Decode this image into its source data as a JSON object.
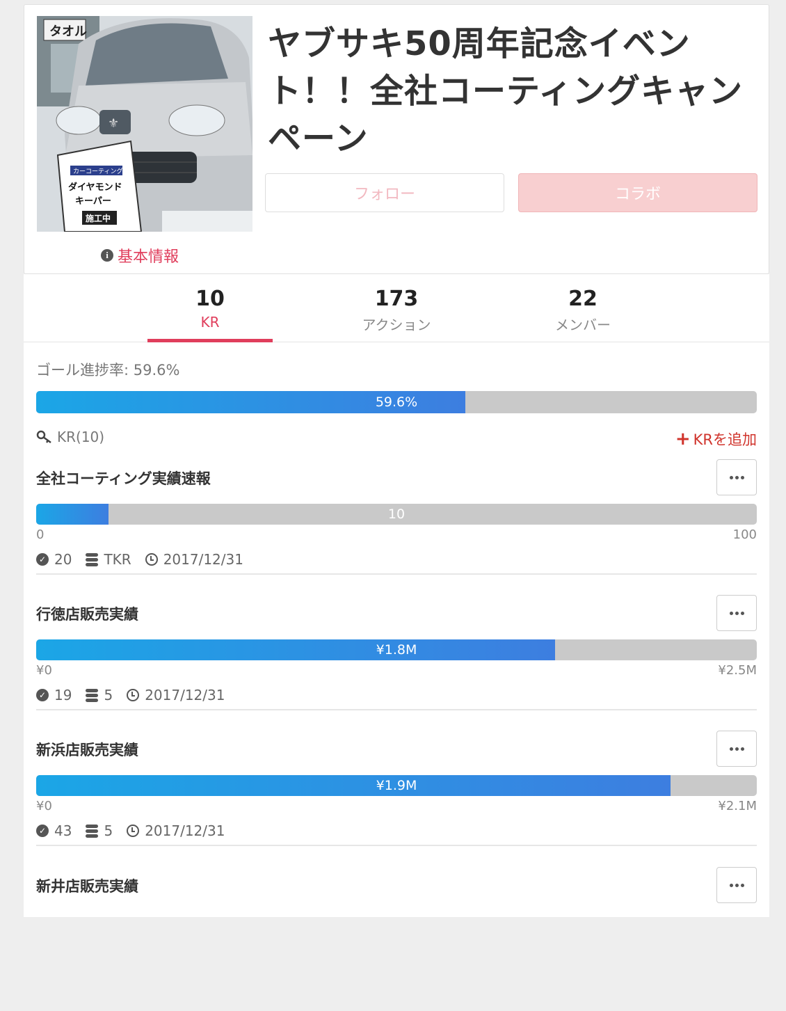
{
  "header": {
    "title": "ヤブサキ50周年記念イベント！！全社コーティングキャンペーン",
    "info_link": "基本情報",
    "follow_label": "フォロー",
    "collab_label": "コラボ",
    "thumbnail": {
      "sign_top": "タオル",
      "sign_small": "カーコーティング",
      "sign_line1": "ダイヤモンド",
      "sign_line2": "キーパー",
      "sign_line3": "施工中"
    }
  },
  "tabs": [
    {
      "count": "10",
      "label": "KR",
      "active": true
    },
    {
      "count": "173",
      "label": "アクション",
      "active": false
    },
    {
      "count": "22",
      "label": "メンバー",
      "active": false
    }
  ],
  "goal": {
    "label": "ゴール進捗率: 59.6%",
    "progress": 0.596,
    "bar_text": "59.6%"
  },
  "kr_section": {
    "count_label": "KR(10)",
    "add_label": "KRを追加"
  },
  "krs": [
    {
      "name": "全社コーティング実績速報",
      "progress": 0.1,
      "bar_text": "10",
      "min": "0",
      "max": "100",
      "done": "20",
      "owner": "TKR",
      "due": "2017/12/31"
    },
    {
      "name": "行徳店販売実績",
      "progress": 0.72,
      "bar_text": "¥1.8M",
      "min": "¥0",
      "max": "¥2.5M",
      "done": "19",
      "owner": "5",
      "due": "2017/12/31"
    },
    {
      "name": "新浜店販売実績",
      "progress": 0.88,
      "bar_text": "¥1.9M",
      "min": "¥0",
      "max": "¥2.1M",
      "done": "43",
      "owner": "5",
      "due": "2017/12/31"
    },
    {
      "name": "新井店販売実績"
    }
  ],
  "colors": {
    "accent": "#e03e5c",
    "bar_start": "#1ba6e6",
    "bar_end": "#3d7ee0",
    "bar_track": "#c9c9c9",
    "add": "#d0342c"
  }
}
